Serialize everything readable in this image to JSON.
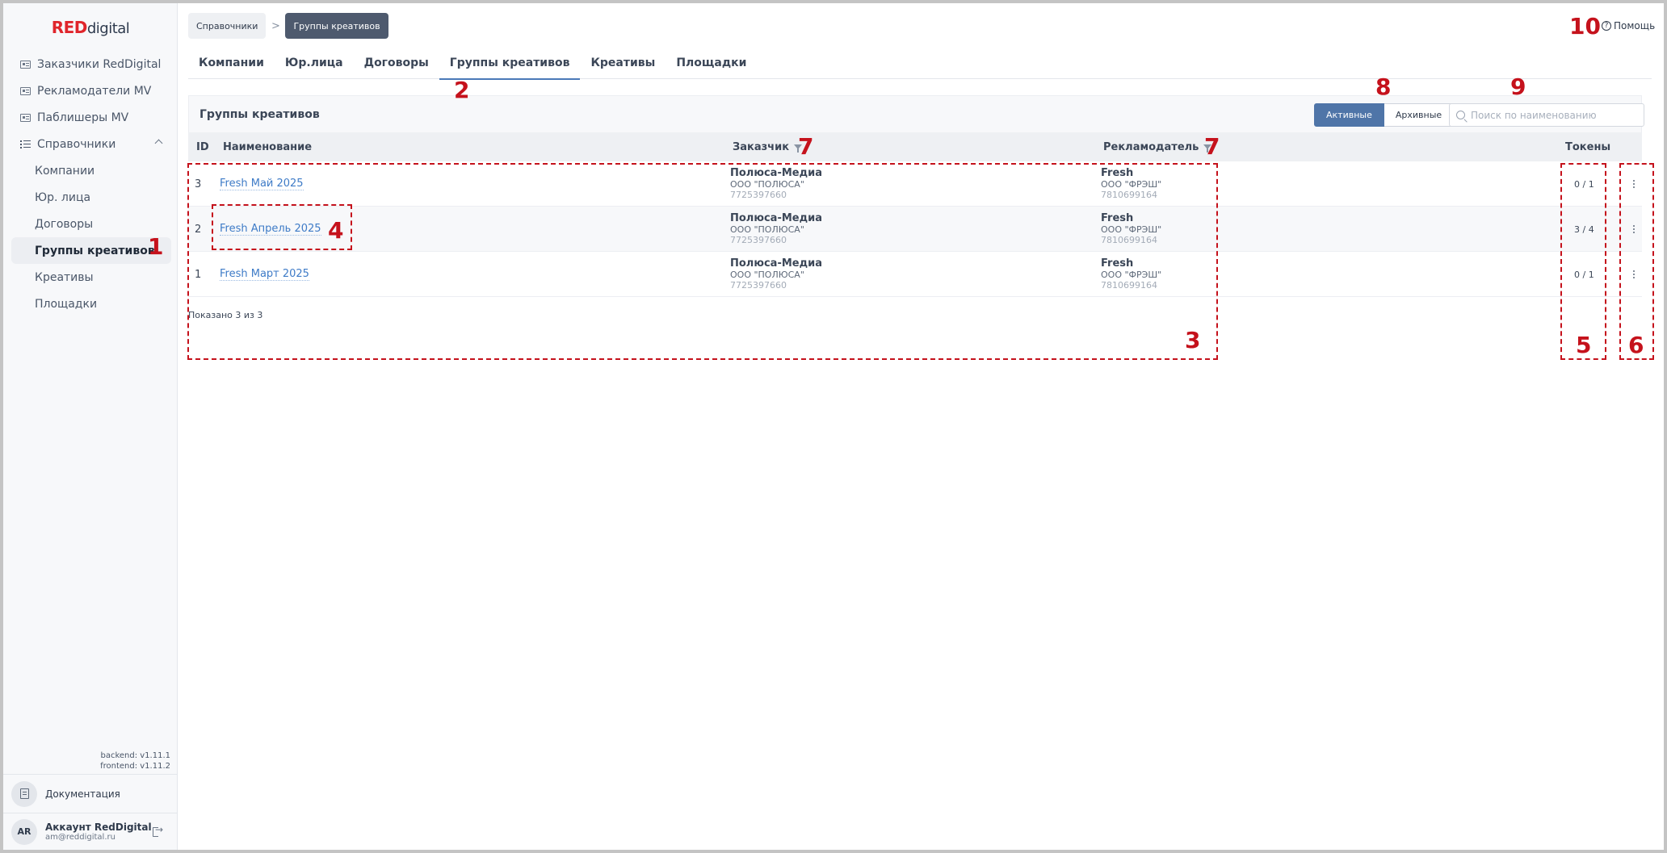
{
  "logo": {
    "red": "RED",
    "rest": "digital"
  },
  "sidebar": {
    "items": [
      {
        "label": "Заказчики RedDigital",
        "icon": "id-card-icon"
      },
      {
        "label": "Рекламодатели MV",
        "icon": "id-card-icon"
      },
      {
        "label": "Паблишеры MV",
        "icon": "id-card-icon"
      },
      {
        "label": "Справочники",
        "icon": "list-icon"
      }
    ],
    "subitems": [
      {
        "label": "Компании"
      },
      {
        "label": "Юр. лица"
      },
      {
        "label": "Договоры"
      },
      {
        "label": "Группы креативов",
        "active": true
      },
      {
        "label": "Креативы"
      },
      {
        "label": "Площадки"
      }
    ],
    "versions": {
      "backend": "backend: v1.11.1",
      "frontend": "frontend: v1.11.2"
    },
    "docs_label": "Документация",
    "account": {
      "initials": "AR",
      "name": "Аккаунт RedDigital",
      "email": "am@reddigital.ru"
    }
  },
  "breadcrumb": {
    "first": "Справочники",
    "sep": ">",
    "current": "Группы креативов"
  },
  "help": {
    "label": "Помощь"
  },
  "tabs": [
    {
      "label": "Компании"
    },
    {
      "label": "Юр.лица"
    },
    {
      "label": "Договоры"
    },
    {
      "label": "Группы креативов",
      "active": true
    },
    {
      "label": "Креативы"
    },
    {
      "label": "Площадки"
    }
  ],
  "card": {
    "title": "Группы креативов",
    "toggle": {
      "active": "Активные",
      "archived": "Архивные"
    },
    "search_placeholder": "Поиск по наименованию"
  },
  "table": {
    "headers": {
      "id": "ID",
      "name": "Наименование",
      "customer": "Заказчик",
      "advertiser": "Рекламодатель",
      "tokens": "Токены"
    },
    "rows": [
      {
        "id": "3",
        "name": "Fresh Май 2025",
        "customer": {
          "name": "Полюса-Медиа",
          "org": "ООО \"ПОЛЮСА\"",
          "inn": "7725397660"
        },
        "advertiser": {
          "name": "Fresh",
          "org": "ООО \"ФРЭШ\"",
          "inn": "7810699164"
        },
        "tokens": "0 / 1"
      },
      {
        "id": "2",
        "name": "Fresh Апрель 2025",
        "customer": {
          "name": "Полюса-Медиа",
          "org": "ООО \"ПОЛЮСА\"",
          "inn": "7725397660"
        },
        "advertiser": {
          "name": "Fresh",
          "org": "ООО \"ФРЭШ\"",
          "inn": "7810699164"
        },
        "tokens": "3 / 4"
      },
      {
        "id": "1",
        "name": "Fresh Март 2025",
        "customer": {
          "name": "Полюса-Медиа",
          "org": "ООО \"ПОЛЮСА\"",
          "inn": "7725397660"
        },
        "advertiser": {
          "name": "Fresh",
          "org": "ООО \"ФРЭШ\"",
          "inn": "7810699164"
        },
        "tokens": "0 / 1"
      }
    ],
    "count_text": "Показано 3 из 3"
  },
  "annotations": {
    "n1": "1",
    "n2": "2",
    "n3": "3",
    "n4": "4",
    "n5": "5",
    "n6": "6",
    "n7a": "7",
    "n7b": "7",
    "n8": "8",
    "n9": "9",
    "n10": "10",
    "color": "#c5121c"
  },
  "colors": {
    "accent": "#4f75a8",
    "link": "#3e7bc7",
    "brand_red": "#e0252b",
    "annotation": "#c5121c"
  }
}
